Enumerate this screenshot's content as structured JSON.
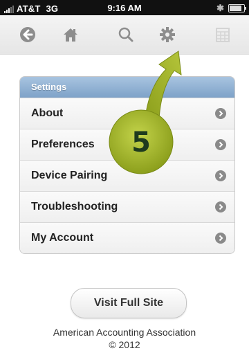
{
  "status_bar": {
    "carrier": "AT&T",
    "network": "3G",
    "time": "9:16 AM"
  },
  "toolbar": {
    "buttons": [
      {
        "icon": "back-arrow-icon"
      },
      {
        "icon": "home-icon"
      },
      {
        "icon": "search-icon"
      },
      {
        "icon": "gear-icon"
      },
      {
        "icon": "calendar-icon"
      }
    ]
  },
  "settings": {
    "header": "Settings",
    "items": [
      {
        "label": "About"
      },
      {
        "label": "Preferences"
      },
      {
        "label": "Device Pairing"
      },
      {
        "label": "Troubleshooting"
      },
      {
        "label": "My Account"
      }
    ]
  },
  "annotation": {
    "step_number": "5",
    "colors": {
      "arrow": "#9aad22",
      "circle_text": "#1e3b1e"
    }
  },
  "footer": {
    "visit_label": "Visit Full Site",
    "organization": "American Accounting Association",
    "copyright": "© 2012"
  },
  "colors": {
    "header_blue": "#7ea2c8",
    "status_bar": "#111111",
    "chevron": "#8a8a8a"
  }
}
